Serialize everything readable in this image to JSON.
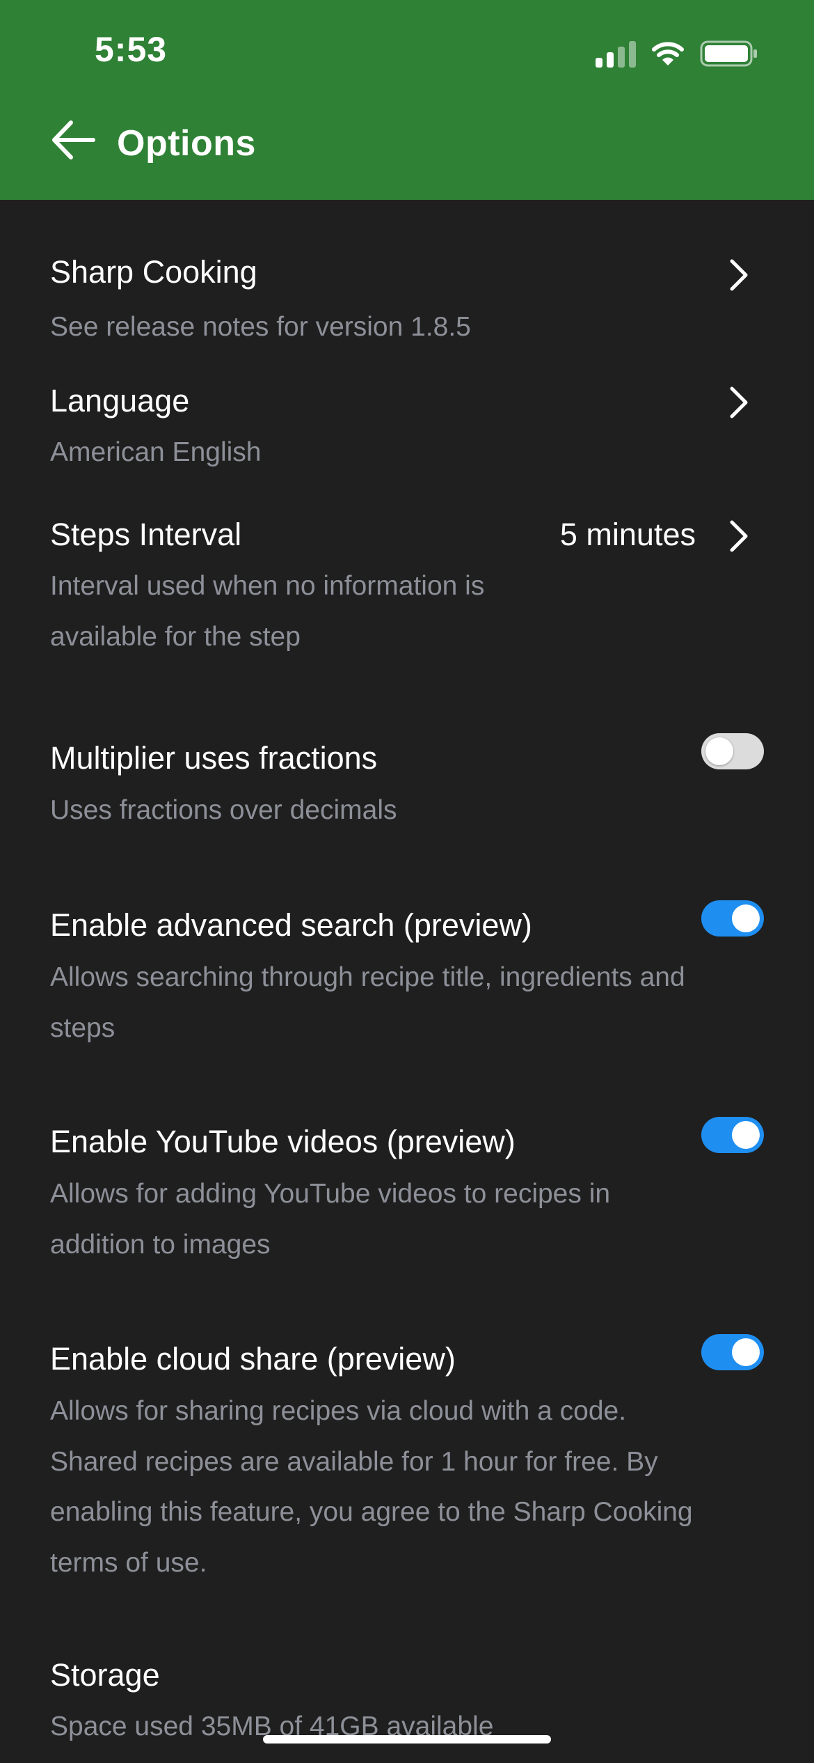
{
  "status_bar": {
    "time": "5:53",
    "icons": [
      "signal-icon",
      "wifi-icon",
      "battery-icon"
    ]
  },
  "header": {
    "title": "Options",
    "back_icon": "back-arrow-icon",
    "background": "#2f8135"
  },
  "options": [
    {
      "id": "sharp-cooking",
      "title": "Sharp Cooking",
      "subtitle": [
        "See release notes for version 1.8.5"
      ],
      "control": "chevron"
    },
    {
      "id": "language",
      "title": "Language",
      "subtitle": [
        "American English"
      ],
      "control": "chevron"
    },
    {
      "id": "steps-interval",
      "title": "Steps Interval",
      "value": "5 minutes",
      "subtitle": [
        "Interval used when no information is",
        "available for the step"
      ],
      "control": "chevron"
    },
    {
      "id": "multiplier-fractions",
      "title": "Multiplier uses fractions",
      "subtitle": [
        "Uses fractions over decimals"
      ],
      "control": "toggle",
      "enabled": false
    },
    {
      "id": "advanced-search",
      "title": "Enable advanced search (preview)",
      "subtitle": [
        "Allows searching through recipe title, ingredients and",
        "steps"
      ],
      "control": "toggle",
      "enabled": true
    },
    {
      "id": "youtube-videos",
      "title": "Enable YouTube videos (preview)",
      "subtitle": [
        "Allows for adding YouTube videos to recipes in",
        "addition to images"
      ],
      "control": "toggle",
      "enabled": true
    },
    {
      "id": "cloud-share",
      "title": "Enable cloud share (preview)",
      "subtitle": [
        "Allows for sharing recipes via cloud with a code.",
        "Shared recipes are available for 1 hour for free. By",
        "enabling this feature, you agree to the Sharp Cooking",
        "terms of use."
      ],
      "control": "toggle",
      "enabled": true
    },
    {
      "id": "storage",
      "title": "Storage",
      "subtitle": [
        "Space used 35MB of 41GB available"
      ],
      "control": "none"
    }
  ],
  "colors": {
    "background": "#1f1f1f",
    "subtitle": "#8d9098",
    "toggle_on": "#1f8ef1",
    "toggle_off": "#dcdcdc"
  }
}
